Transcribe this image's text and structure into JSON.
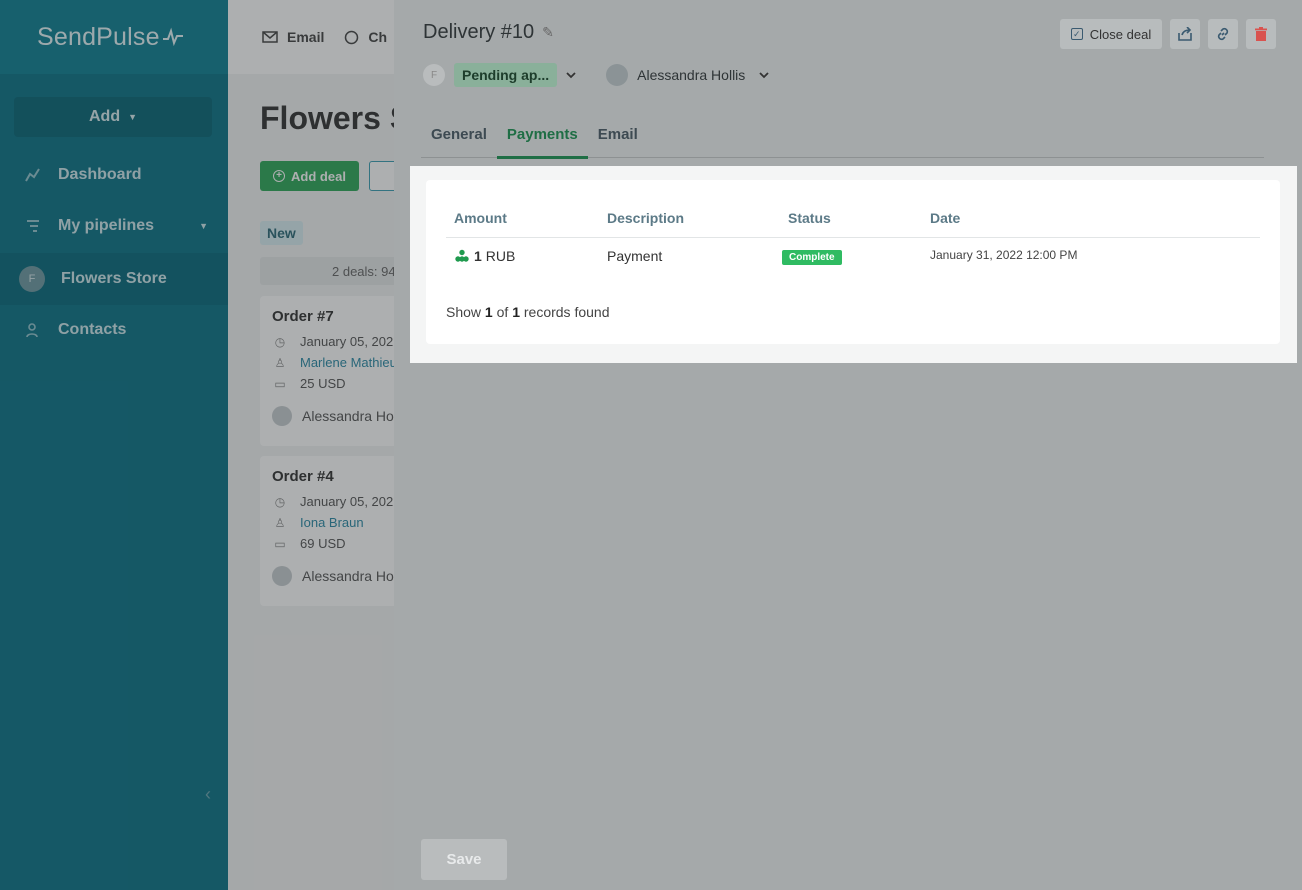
{
  "sidebar": {
    "logo": "SendPulse",
    "add_label": "Add",
    "items": [
      {
        "label": "Dashboard"
      },
      {
        "label": "My pipelines"
      },
      {
        "label": "Flowers Store",
        "avatar": "F"
      },
      {
        "label": "Contacts"
      }
    ]
  },
  "topbar": {
    "email": "Email",
    "chat": "Ch"
  },
  "board": {
    "title": "Flowers S",
    "add_deal": "Add deal",
    "stage": "New",
    "stage_summary": "2 deals: 94",
    "cards": [
      {
        "title": "Order #7",
        "date": "January 05, 202",
        "contact": "Marlene Mathieu",
        "amount": "25 USD",
        "owner": "Alessandra Ho"
      },
      {
        "title": "Order #4",
        "date": "January 05, 202",
        "contact": "Iona Braun",
        "amount": "69 USD",
        "owner": "Alessandra Ho"
      }
    ]
  },
  "deal": {
    "title": "Delivery #10",
    "avatar_letter": "F",
    "status": "Pending ap...",
    "owner": "Alessandra Hollis",
    "close_label": "Close deal",
    "tabs": [
      "General",
      "Payments",
      "Email"
    ],
    "active_tab": "Payments",
    "save_label": "Save"
  },
  "payments": {
    "columns": [
      "Amount",
      "Description",
      "Status",
      "Date"
    ],
    "rows": [
      {
        "amount_value": "1",
        "currency": "RUB",
        "description": "Payment",
        "status": "Complete",
        "date": "January 31, 2022 12:00 PM"
      }
    ],
    "footer_show": "Show",
    "footer_count": "1",
    "footer_of": "of",
    "footer_total": "1",
    "footer_suffix": "records found"
  },
  "colors": {
    "sidebar": "#0a7387",
    "accent_green": "#2ea85a",
    "status_complete": "#2fbb62",
    "delete_red": "#d9534f"
  }
}
